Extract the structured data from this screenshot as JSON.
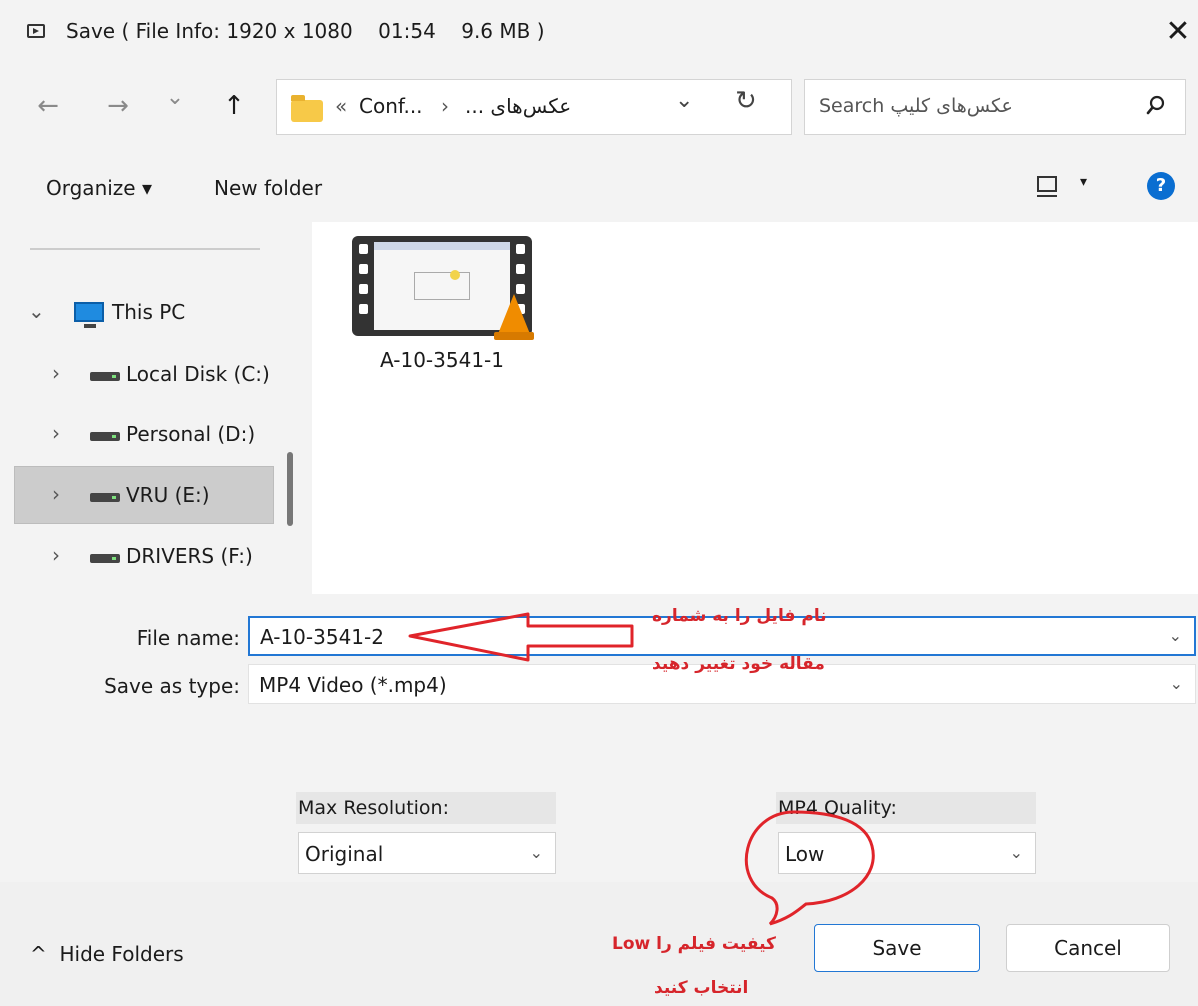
{
  "window": {
    "title": "Save ( File Info: 1920 x 1080    01:54    9.6 MB )",
    "close_glyph": "✕"
  },
  "nav": {
    "back_glyph": "←",
    "forward_glyph": "→",
    "recent_glyph": "⌄",
    "up_glyph": "↑",
    "breadcrumb_prefix": "«",
    "breadcrumb_1": "Conf...",
    "breadcrumb_sep": "›",
    "breadcrumb_2": "عکس‌های ...",
    "address_dropdown_glyph": "⌄",
    "refresh_glyph": "↻",
    "search_placeholder": "Search عکس‌های کلیپ"
  },
  "toolbar": {
    "organize": "Organize ▾",
    "new_folder": "New folder",
    "view_caret": "▾",
    "help": "?"
  },
  "nav_tree": [
    {
      "label": "This PC",
      "chevron": "⌄",
      "icon": "pc-icon"
    },
    {
      "label": "Local Disk (C:)",
      "chevron": "›",
      "icon": "windows-drive-icon"
    },
    {
      "label": "Personal (D:)",
      "chevron": "›",
      "icon": "drive-icon"
    },
    {
      "label": "VRU (E:)",
      "chevron": "›",
      "icon": "drive-icon",
      "selected": true
    },
    {
      "label": "DRIVERS (F:)",
      "chevron": "›",
      "icon": "drive-icon"
    }
  ],
  "files": [
    {
      "name": "A-10-3541-1",
      "icon": "vlc-video-icon"
    }
  ],
  "form": {
    "file_name_label": "File name:",
    "file_name_value": "A-10-3541-2",
    "save_type_label": "Save as type:",
    "save_type_value": "MP4 Video (*.mp4)",
    "chevron": "⌄",
    "max_resolution_label": "Max Resolution:",
    "max_resolution_value": "Original",
    "quality_label": "MP4 Quality:",
    "quality_value": "Low"
  },
  "footer": {
    "hide_folders": "^  Hide Folders",
    "save": "Save",
    "cancel": "Cancel"
  },
  "annotations": {
    "rename_line1": "نام فایل را به شماره",
    "rename_line2": "مقاله خود تغییر دهید",
    "quality_line1": "کیفیت فیلم را Low",
    "quality_line2": "انتخاب کنید",
    "color": "#d6252b"
  }
}
